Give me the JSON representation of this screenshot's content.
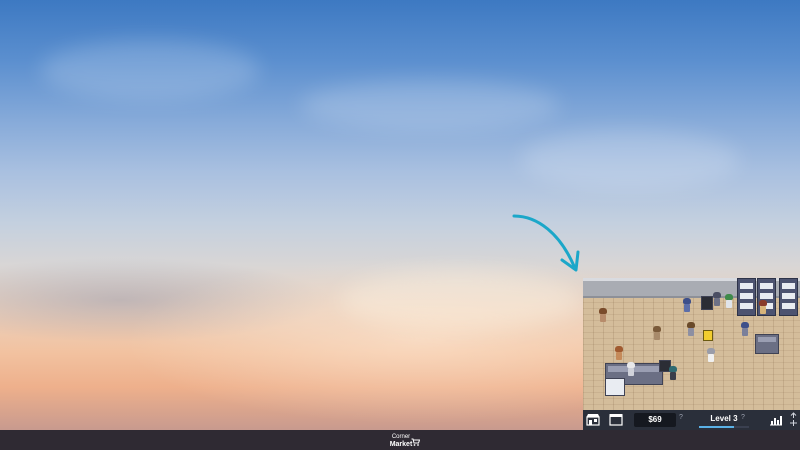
{
  "taskbar": {
    "logo_line1": "Corner",
    "logo_line2": "Market",
    "logo_icon": "cart-icon"
  },
  "game": {
    "money": "$69",
    "money_help": "?",
    "level": "Level 3",
    "level_help": "?",
    "level_progress": 0.7,
    "icons": {
      "store": "store-icon",
      "storage": "storage-box-icon",
      "stats": "stats-chart-icon",
      "expand": "expand-icon"
    }
  },
  "colors": {
    "arrow": "#1ba7c9",
    "toolbar": "#2a2f3a",
    "taskbar": "#2f2a33",
    "level_fill": "#5ab1e6"
  }
}
